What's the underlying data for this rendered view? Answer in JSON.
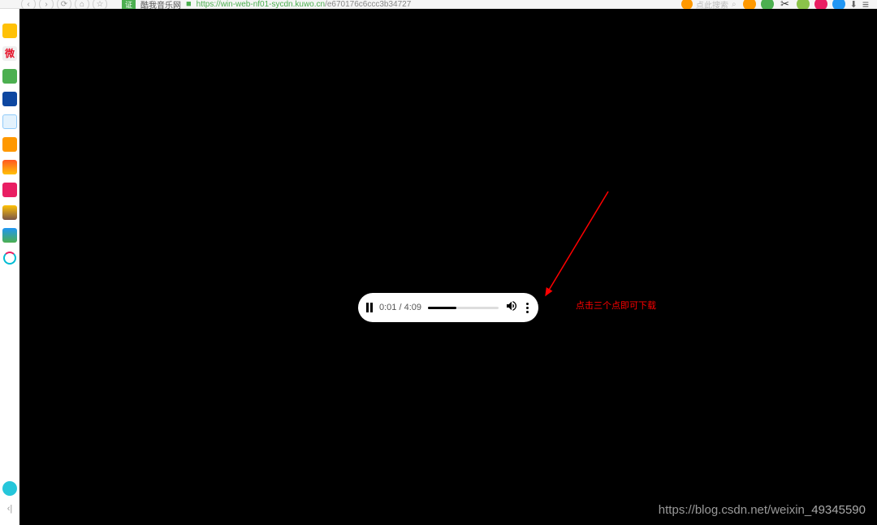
{
  "browser": {
    "site_badge": "证",
    "site_name": "酷我音乐网",
    "url_protocol": "https://",
    "url_host": "win-web-nf01-sycdn.kuwo.cn",
    "url_path": "/e670176c6ccc3b34727",
    "search_placeholder": "点此搜索",
    "search_icon_char": "⌕"
  },
  "player": {
    "current_time": "0:01",
    "separator": " / ",
    "total_time": "4:09",
    "progress_percent": 0.4
  },
  "annotation": {
    "text": "点击三个点即可下载"
  },
  "watermark": {
    "url": "https://blog.csdn.net/weixin_",
    "id": "49345590"
  },
  "icons": {
    "pause": "pause-icon",
    "volume": "volume-icon",
    "three_dots": "three-dots-icon",
    "star": "star-icon",
    "weibo_char": "微"
  }
}
